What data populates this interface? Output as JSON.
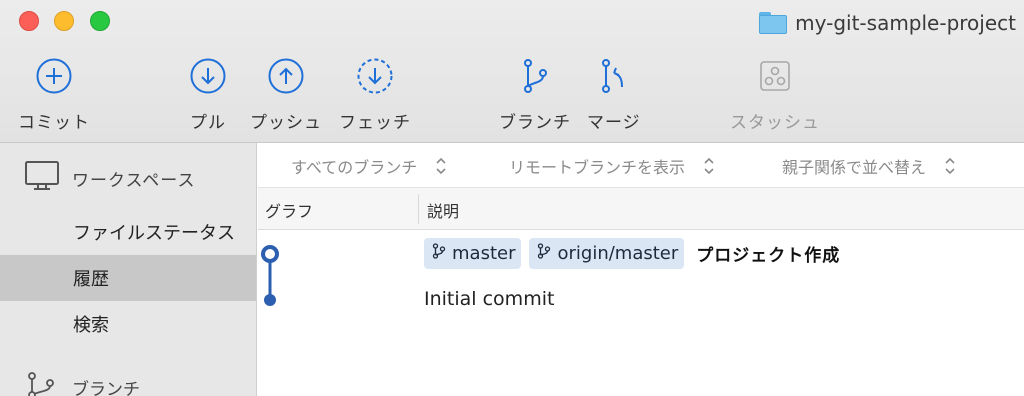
{
  "window": {
    "title": "my-git-sample-project",
    "folder_icon": "folder-icon"
  },
  "toolbar": {
    "commit": {
      "label": "コミット",
      "icon": "plus-circle-icon"
    },
    "pull": {
      "label": "プル",
      "icon": "arrow-down-circle-icon"
    },
    "push": {
      "label": "プッシュ",
      "icon": "arrow-up-circle-icon"
    },
    "fetch": {
      "label": "フェッチ",
      "icon": "fetch-dashed-circle-icon"
    },
    "branch": {
      "label": "ブランチ",
      "icon": "branch-icon"
    },
    "merge": {
      "label": "マージ",
      "icon": "merge-icon"
    },
    "stash": {
      "label": "スタッシュ",
      "icon": "stash-icon",
      "disabled": true
    }
  },
  "sidebar": {
    "workspace_label": "ワークスペース",
    "items": [
      {
        "label": "ファイルステータス"
      },
      {
        "label": "履歴",
        "selected": true
      },
      {
        "label": "検索"
      }
    ],
    "branches_label": "ブランチ"
  },
  "filters": {
    "branches": "すべてのブランチ",
    "remote": "リモートブランチを表示",
    "sort": "親子関係で並べ替え"
  },
  "columns": {
    "graph": "グラフ",
    "description": "説明"
  },
  "commits": [
    {
      "tags": [
        "master",
        "origin/master"
      ],
      "message": "プロジェクト作成"
    },
    {
      "message": "Initial commit"
    }
  ],
  "colors": {
    "accent": "#1f6fd8",
    "graph": "#2d5fb0",
    "tag_bg": "#dbe6f4",
    "sidebar_bg": "#e7e7e7",
    "sidebar_selected": "#c8c8c8"
  }
}
